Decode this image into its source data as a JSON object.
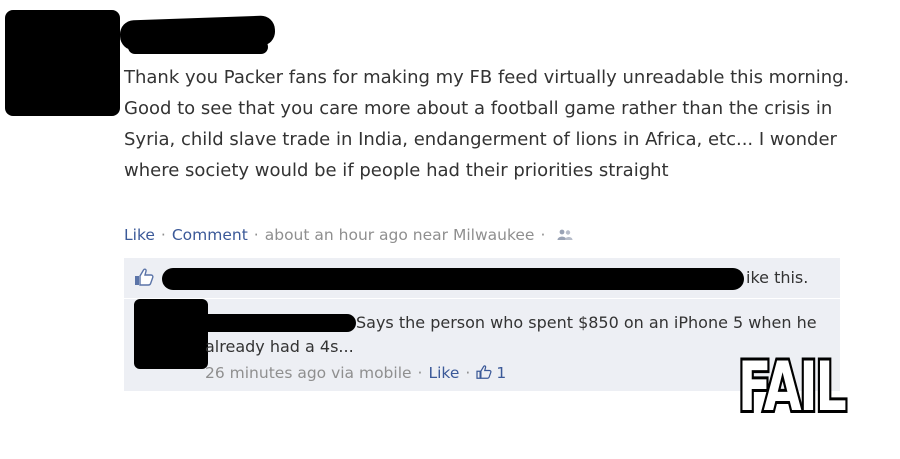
{
  "post": {
    "text": "Thank you Packer fans for making my FB feed virtually unreadable this morning. Good to see that you care more about a football game rather than the crisis in Syria, child slave trade in India, endangerment of lions in Africa, etc... I wonder where society would be if people had their priorities straight",
    "like_label": "Like",
    "comment_label": "Comment",
    "timestamp": "about an hour ago near Milwaukee",
    "audience_icon": "friends-icon"
  },
  "likes": {
    "text": "ike this.",
    "icon": "thumbs-up-icon"
  },
  "comment": {
    "text": "Says the person who spent $850 on an iPhone 5 when he already had a 4s...",
    "timestamp": "26 minutes ago via mobile",
    "like_label": "Like",
    "like_count": "1",
    "like_icon": "thumbs-up-icon"
  },
  "stamp": {
    "text": "FAIL"
  },
  "colors": {
    "link": "#3b5998",
    "meta": "#8f8f8f",
    "comment_bg": "#edeff4"
  }
}
